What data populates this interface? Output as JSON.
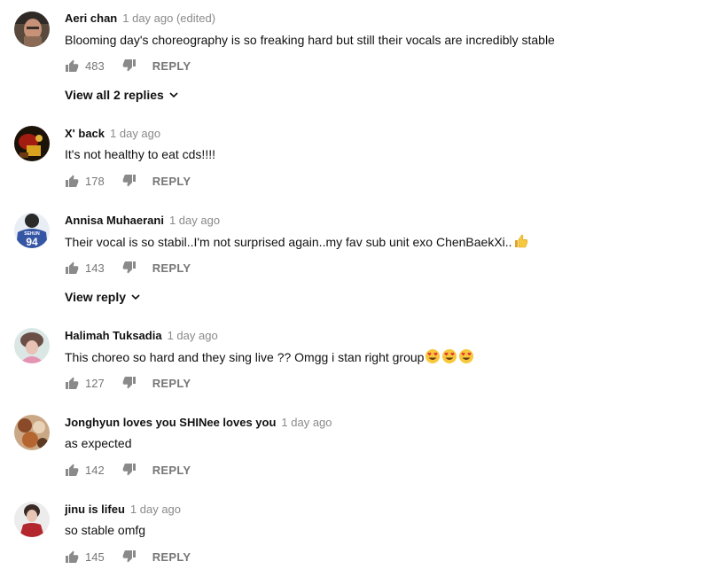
{
  "comments": [
    {
      "author": "Aeri chan",
      "time": "1 day ago (edited)",
      "text": "Blooming day's choreography is so freaking hard but still their vocals are incredibly stable",
      "likes": "483",
      "reply_label": "REPLY",
      "view_replies": "View all 2 replies"
    },
    {
      "author": "X' back",
      "time": "1 day ago",
      "text": "It's not healthy to eat cds!!!!",
      "likes": "178",
      "reply_label": "REPLY"
    },
    {
      "author": "Annisa Muhaerani",
      "time": "1 day ago",
      "text": "Their vocal is so stabil..I'm not surprised again..my fav sub unit exo ChenBaekXi..",
      "likes": "143",
      "reply_label": "REPLY",
      "view_replies": "View reply",
      "avatar_text": [
        "SEHUN",
        "94"
      ]
    },
    {
      "author": "Halimah Tuksadia",
      "time": "1 day ago",
      "text": "This choreo so hard and they sing live ?? Omgg i stan right group",
      "likes": "127",
      "reply_label": "REPLY"
    },
    {
      "author": "Jonghyun loves you SHINee loves you",
      "time": "1 day ago",
      "text": "as expected",
      "likes": "142",
      "reply_label": "REPLY"
    },
    {
      "author": "jinu is lifeu",
      "time": "1 day ago",
      "text": "so stable omfg",
      "likes": "145",
      "reply_label": "REPLY"
    }
  ],
  "icons": {
    "like": "thumbs-up-icon",
    "dislike": "thumbs-down-icon",
    "expand": "chevron-down-icon",
    "emoji_thumb": "thumbs-up-emoji",
    "emoji_heart_eyes": "heart-eyes-emoji"
  },
  "colors": {
    "author": "#111111",
    "timestamp": "#8a8a8a",
    "action": "#767676",
    "emoji": "#f7c83b"
  }
}
